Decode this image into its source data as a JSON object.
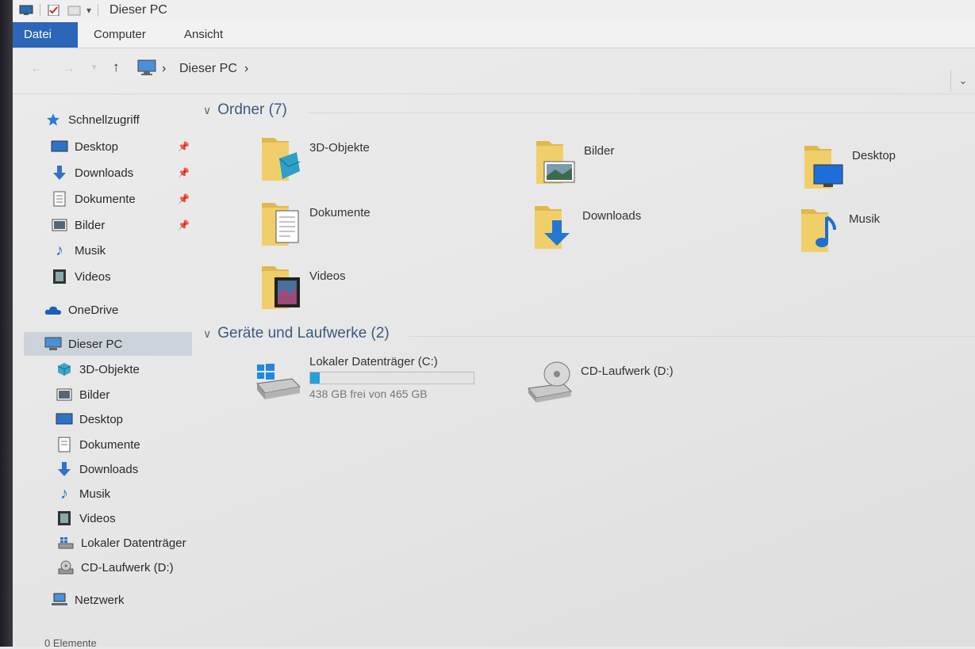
{
  "window": {
    "title": "Dieser PC",
    "status": "0 Elemente"
  },
  "ribbon": {
    "tabs": [
      "Datei",
      "Computer",
      "Ansicht"
    ]
  },
  "address": {
    "path": [
      "Dieser PC"
    ]
  },
  "sidebar": {
    "quick_access": {
      "label": "Schnellzugriff",
      "items": [
        {
          "label": "Desktop",
          "icon": "desktop-icon",
          "pinned": true
        },
        {
          "label": "Downloads",
          "icon": "download-icon",
          "pinned": true
        },
        {
          "label": "Dokumente",
          "icon": "document-icon",
          "pinned": true
        },
        {
          "label": "Bilder",
          "icon": "pictures-icon",
          "pinned": true
        },
        {
          "label": "Musik",
          "icon": "music-icon",
          "pinned": false
        },
        {
          "label": "Videos",
          "icon": "video-icon",
          "pinned": false
        }
      ]
    },
    "onedrive": "OneDrive",
    "this_pc": {
      "label": "Dieser PC",
      "items": [
        {
          "label": "3D-Objekte",
          "icon": "3d-objects-icon"
        },
        {
          "label": "Bilder",
          "icon": "pictures-icon"
        },
        {
          "label": "Desktop",
          "icon": "desktop-icon"
        },
        {
          "label": "Dokumente",
          "icon": "document-icon"
        },
        {
          "label": "Downloads",
          "icon": "download-icon"
        },
        {
          "label": "Musik",
          "icon": "music-icon"
        },
        {
          "label": "Videos",
          "icon": "video-icon"
        },
        {
          "label": "Lokaler Datenträger",
          "icon": "hard-drive-icon"
        },
        {
          "label": "CD-Laufwerk (D:)",
          "icon": "cd-drive-icon"
        }
      ]
    },
    "network": "Netzwerk"
  },
  "content": {
    "folders_header": "Ordner (7)",
    "folders": [
      {
        "label": "3D-Objekte",
        "icon": "3d-objects-folder-icon"
      },
      {
        "label": "Bilder",
        "icon": "pictures-folder-icon"
      },
      {
        "label": "Desktop",
        "icon": "desktop-folder-icon"
      },
      {
        "label": "Dokumente",
        "icon": "documents-folder-icon"
      },
      {
        "label": "Downloads",
        "icon": "downloads-folder-icon"
      },
      {
        "label": "Musik",
        "icon": "music-folder-icon"
      },
      {
        "label": "Videos",
        "icon": "videos-folder-icon"
      }
    ],
    "devices_header": "Geräte und Laufwerke (2)",
    "drives": [
      {
        "label": "Lokaler Datenträger (C:)",
        "free_text": "438 GB frei von 465 GB",
        "used_fraction": 0.058,
        "icon": "windows-drive-icon"
      },
      {
        "label": "CD-Laufwerk (D:)",
        "icon": "cd-drive-icon"
      }
    ]
  },
  "colors": {
    "accent": "#2b66b8",
    "header_text": "#3d5a80",
    "folder": "#e8c25c",
    "drive_bar": "#26a0da"
  }
}
